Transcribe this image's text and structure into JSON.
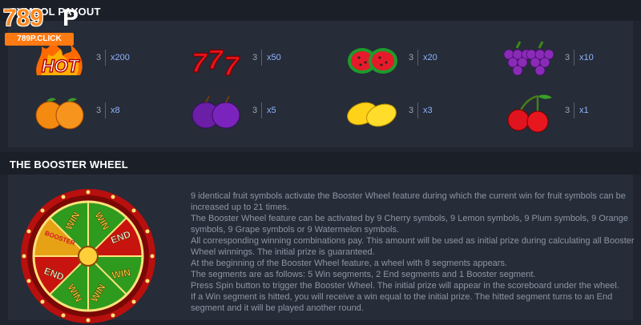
{
  "logo": {
    "number": "789",
    "letter": "P",
    "subtitle": "789P.CLICK"
  },
  "payout": {
    "title": "SYMBOL PAYOUT",
    "rows": [
      [
        {
          "icon": "hot-icon",
          "count": "3",
          "multiplier": "x200"
        },
        {
          "icon": "seven-icon",
          "count": "3",
          "multiplier": "x50"
        },
        {
          "icon": "watermelon-icon",
          "count": "3",
          "multiplier": "x20"
        },
        {
          "icon": "grape-icon",
          "count": "3",
          "multiplier": "x10"
        }
      ],
      [
        {
          "icon": "orange-icon",
          "count": "3",
          "multiplier": "x8"
        },
        {
          "icon": "plum-icon",
          "count": "3",
          "multiplier": "x5"
        },
        {
          "icon": "lemon-icon",
          "count": "3",
          "multiplier": "x3"
        },
        {
          "icon": "cherry-icon",
          "count": "3",
          "multiplier": "x1"
        }
      ]
    ]
  },
  "booster": {
    "title": "THE BOOSTER WHEEL",
    "wheel_labels": {
      "win": "WIN",
      "end": "END",
      "booster": "BOOSTER"
    },
    "paragraphs": [
      "9 identical fruit symbols activate the Booster Wheel feature during which the current win for fruit symbols can be increased up to 21 times.",
      "The Booster Wheel feature can be activated by 9 Cherry symbols, 9 Lemon symbols, 9 Plum symbols, 9 Orange symbols, 9 Grape symbols or 9 Watermelon symbols.",
      "All corresponding winning combinations pay. This amount will be used as initial prize during calculating all Booster Wheel winnings. The initial prize is guaranteed.",
      "At the beginning of the Booster Wheel feature, a wheel with 8 segments appears.",
      "The segments are as follows: 5 Win segments, 2 End segments and 1 Booster segment.",
      "Press Spin button to trigger the Booster Wheel. The initial prize will appear in the scoreboard under the wheel.",
      "If a Win segment is hitted, you will receive a win equal to the initial prize. The hitted segment turns to an End segment and it will be played another round."
    ]
  },
  "colors": {
    "background": "#1f242e",
    "panel": "#262c38",
    "multiplier": "#8fb4ff",
    "body_text": "#8e96a4",
    "logo_orange": "#ff8a1f"
  }
}
